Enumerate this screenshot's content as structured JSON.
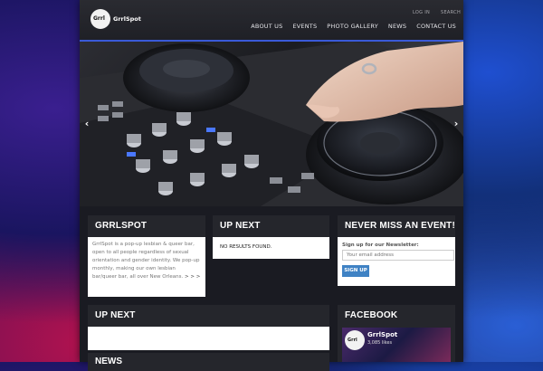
{
  "header": {
    "logo_text": "GrrlSpot",
    "logo_badge": "Grrl",
    "util_links": [
      "LOG IN",
      "SEARCH"
    ],
    "nav": [
      "ABOUT US",
      "EVENTS",
      "PHOTO GALLERY",
      "NEWS",
      "CONTACT US"
    ]
  },
  "slider": {
    "prev": "‹",
    "next": "›"
  },
  "grrlspot": {
    "title": "GRRLSPOT",
    "body": "GrrlSpot is a pop-up lesbian & queer bar, open to all people regardless of sexual orientation and gender identity. We pop-up monthly, making our own lesbian bar/queer bar, all over New Orleans.",
    "more": "> > >"
  },
  "upnext_small": {
    "title": "UP NEXT",
    "body": "NO RESULTS FOUND."
  },
  "newsletter": {
    "title": "NEVER MISS AN EVENT!",
    "label": "Sign up for our Newsletter:",
    "placeholder": "Your email address",
    "button": "SIGN UP"
  },
  "upnext_wide": {
    "title": "UP NEXT"
  },
  "news": {
    "title": "NEWS"
  },
  "facebook": {
    "title": "FACEBOOK",
    "page_name": "GrrlSpot",
    "likes": "3,085 likes"
  }
}
